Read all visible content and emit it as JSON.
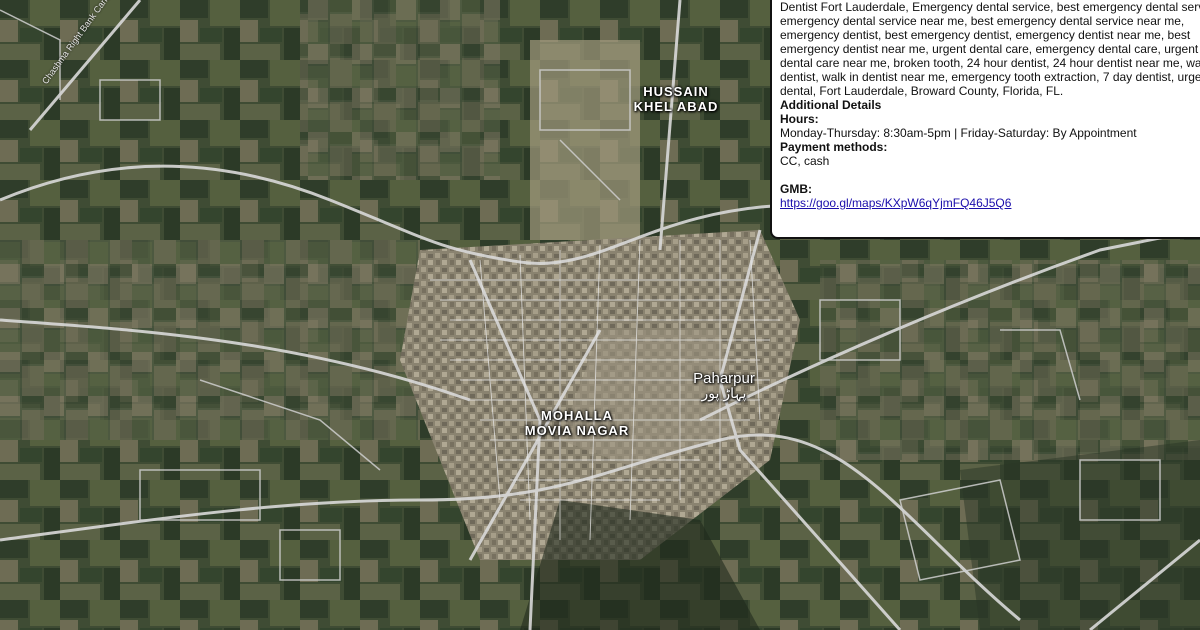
{
  "map": {
    "labels": {
      "hussain_khel_abad": [
        "HUSSAIN",
        "KHEL ABAD"
      ],
      "mohalla_movia_nagar": [
        "MOHALLA",
        "MOVIA NAGAR"
      ],
      "paharpur": "Paharpur",
      "paharpur_urdu": "پہاڑ پور",
      "road_name": "Chashma Right Bank Canal"
    }
  },
  "popup": {
    "keywords": "Dental Implants Fort Lauderdale , Cosmetic Dentist Fort Lauderdale , Emergency Dentist  Fort Lauderdale, Emergency dental service, best emergency dental service, emergency dental service near me,  best emergency dental service near me, emergency dentist, best emergency dentist, emergency dentist near me, best emergency dentist near me, urgent dental care, emergency dental care, urgent dental care near me, broken tooth, 24 hour dentist, 24 hour dentist near me, walk in dentist, walk in dentist near me, emergency tooth extraction, 7 day dentist, urgent dental, Fort Lauderdale, Broward County, Florida, FL.",
    "additional_details": "Additional Details",
    "hours_label": "Hours:",
    "hours_value": "Monday-Thursday: 8:30am-5pm | Friday-Saturday: By Appointment",
    "payment_label": "Payment methods:",
    "payment_value": "CC, cash",
    "gmb_label": "GMB:",
    "gmb_link": "https://goo.gl/maps/KXpW6qYjmFQ46J5Q6"
  },
  "colors": {
    "field_dark": "#2f3d2a",
    "field_mid": "#4f5f3f",
    "field_light": "#7a7a5e",
    "urban": "#8f8775",
    "road": "#d8d8d8",
    "popup_bg": "#ffffff",
    "link": "#1a0dab"
  }
}
